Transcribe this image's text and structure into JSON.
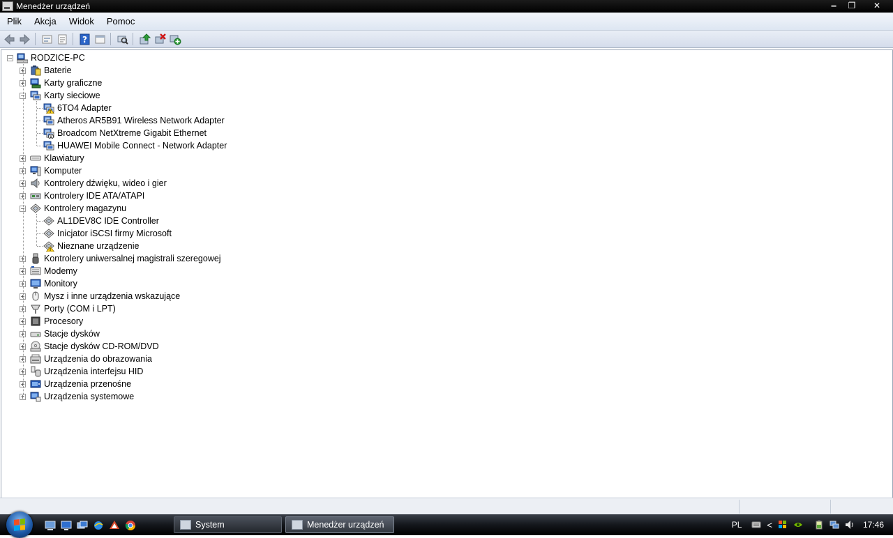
{
  "window": {
    "title": "Menedżer urządzeń",
    "buttons": {
      "minimize": "‒",
      "restore": "❐",
      "close": "✕"
    }
  },
  "menu": [
    "Plik",
    "Akcja",
    "Widok",
    "Pomoc"
  ],
  "toolbar": {
    "buttons": [
      "back-icon",
      "forward-icon",
      "up-icon",
      "properties-icon",
      "help-icon",
      "view-icon",
      "scan-hardware-icon",
      "update-driver-icon",
      "uninstall-icon",
      "enable-device-icon"
    ]
  },
  "tree": {
    "root": "RODZICE-PC",
    "categories": [
      {
        "label": "Baterie",
        "icon": "battery-icon",
        "expanded": false
      },
      {
        "label": "Karty graficzne",
        "icon": "display-adapter-icon",
        "expanded": false
      },
      {
        "label": "Karty sieciowe",
        "icon": "network-adapter-icon",
        "expanded": true,
        "children": [
          {
            "label": "6TO4 Adapter",
            "icon": "network-warning-icon"
          },
          {
            "label": "Atheros AR5B91 Wireless Network Adapter",
            "icon": "network-adapter-icon"
          },
          {
            "label": "Broadcom NetXtreme Gigabit Ethernet",
            "icon": "network-disabled-icon"
          },
          {
            "label": "HUAWEI Mobile Connect - Network Adapter",
            "icon": "network-adapter-icon"
          }
        ]
      },
      {
        "label": "Klawiatury",
        "icon": "keyboard-icon",
        "expanded": false
      },
      {
        "label": "Komputer",
        "icon": "computer-icon",
        "expanded": false
      },
      {
        "label": "Kontrolery dźwięku, wideo i gier",
        "icon": "speaker-icon",
        "expanded": false
      },
      {
        "label": "Kontrolery IDE ATA/ATAPI",
        "icon": "ide-controller-icon",
        "expanded": false
      },
      {
        "label": "Kontrolery magazynu",
        "icon": "storage-controller-icon",
        "expanded": true,
        "children": [
          {
            "label": "AL1DEV8C IDE Controller",
            "icon": "storage-controller-icon"
          },
          {
            "label": "Inicjator iSCSI firmy Microsoft",
            "icon": "storage-controller-icon"
          },
          {
            "label": "Nieznane urządzenie",
            "icon": "unknown-device-warning-icon"
          }
        ]
      },
      {
        "label": "Kontrolery uniwersalnej magistrali szeregowej",
        "icon": "usb-icon",
        "expanded": false
      },
      {
        "label": "Modemy",
        "icon": "modem-icon",
        "expanded": false
      },
      {
        "label": "Monitory",
        "icon": "monitor-icon",
        "expanded": false
      },
      {
        "label": "Mysz i inne urządzenia wskazujące",
        "icon": "mouse-icon",
        "expanded": false
      },
      {
        "label": "Porty (COM i LPT)",
        "icon": "port-icon",
        "expanded": false
      },
      {
        "label": "Procesory",
        "icon": "processor-icon",
        "expanded": false
      },
      {
        "label": "Stacje dysków",
        "icon": "disk-drive-icon",
        "expanded": false
      },
      {
        "label": "Stacje dysków CD-ROM/DVD",
        "icon": "cdrom-icon",
        "expanded": false
      },
      {
        "label": "Urządzenia do obrazowania",
        "icon": "imaging-icon",
        "expanded": false
      },
      {
        "label": "Urządzenia interfejsu HID",
        "icon": "hid-icon",
        "expanded": false
      },
      {
        "label": "Urządzenia przenośne",
        "icon": "portable-device-icon",
        "expanded": false
      },
      {
        "label": "Urządzenia systemowe",
        "icon": "system-device-icon",
        "expanded": false
      }
    ]
  },
  "taskbar": {
    "quicklaunch": [
      "show-desktop-icon",
      "computer-icon",
      "switch-windows-icon",
      "internet-explorer-icon",
      "media-icon",
      "chrome-icon"
    ],
    "tasks": [
      {
        "label": "System",
        "active": false
      },
      {
        "label": "Menedżer urządzeń",
        "active": true
      }
    ],
    "tray": {
      "language": "PL",
      "time": "17:46"
    }
  }
}
